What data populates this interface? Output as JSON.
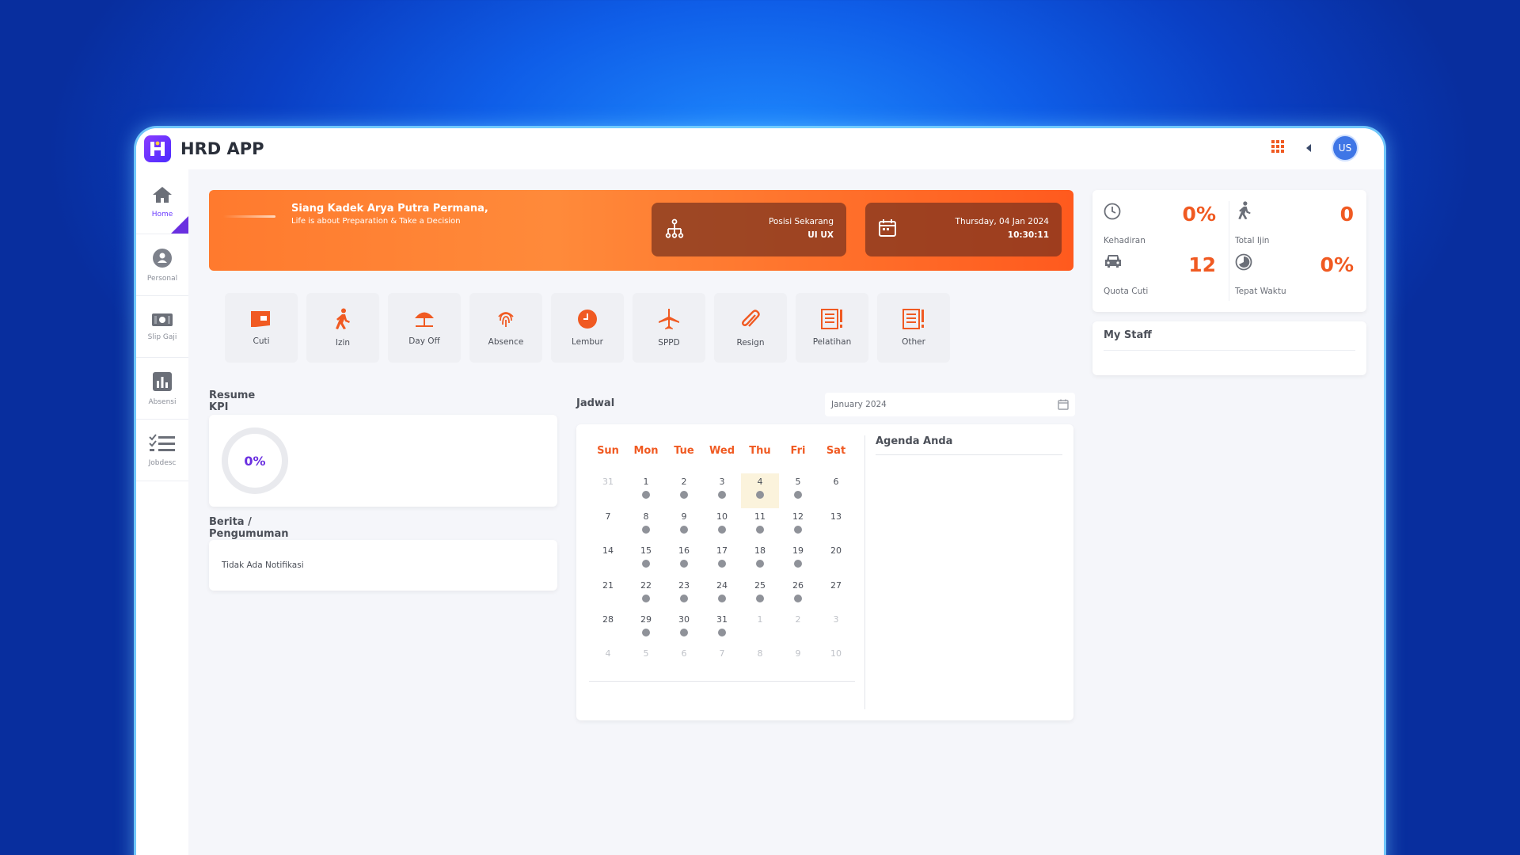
{
  "app": {
    "title": "HRD APP",
    "user_initials": "US"
  },
  "sidebar": {
    "items": [
      {
        "label": "Home",
        "icon": "home-icon",
        "active": true
      },
      {
        "label": "Personal",
        "icon": "user-icon",
        "active": false
      },
      {
        "label": "Slip Gaji",
        "icon": "money-icon",
        "active": false
      },
      {
        "label": "Absensi",
        "icon": "bar-chart-icon",
        "active": false
      },
      {
        "label": "Jobdesc",
        "icon": "checklist-icon",
        "active": false
      }
    ]
  },
  "banner": {
    "greeting": "Siang Kadek Arya Putra Permana,",
    "subtitle": "Life is about Preparation & Take a Decision",
    "position_label": "Posisi Sekarang",
    "position_value": "UI UX",
    "date": "Thursday, 04 Jan 2024",
    "time": "10:30:11"
  },
  "quick_actions": [
    {
      "label": "Cuti",
      "icon": "leave-icon"
    },
    {
      "label": "Izin",
      "icon": "walking-icon"
    },
    {
      "label": "Day Off",
      "icon": "beach-umbrella-icon"
    },
    {
      "label": "Absence",
      "icon": "fingerprint-icon"
    },
    {
      "label": "Lembur",
      "icon": "clock-icon"
    },
    {
      "label": "SPPD",
      "icon": "airplane-icon"
    },
    {
      "label": "Resign",
      "icon": "paperclip-icon"
    },
    {
      "label": "Pelatihan",
      "icon": "document-icon"
    },
    {
      "label": "Other",
      "icon": "document-icon"
    }
  ],
  "kpi": {
    "title": "Resume KPI",
    "value": "0%"
  },
  "news": {
    "title": "Berita / Pengumuman",
    "empty_text": "Tidak Ada Notifikasi"
  },
  "schedule": {
    "title": "Jadwal",
    "month_value": "January 2024",
    "agenda_title": "Agenda Anda",
    "weekdays": [
      "Sun",
      "Mon",
      "Tue",
      "Wed",
      "Thu",
      "Fri",
      "Sat"
    ],
    "weeks": [
      [
        "31",
        "1",
        "2",
        "3",
        "4",
        "5",
        "6"
      ],
      [
        "7",
        "8",
        "9",
        "10",
        "11",
        "12",
        "13"
      ],
      [
        "14",
        "15",
        "16",
        "17",
        "18",
        "19",
        "20"
      ],
      [
        "21",
        "22",
        "23",
        "24",
        "25",
        "26",
        "27"
      ],
      [
        "28",
        "29",
        "30",
        "31",
        "1",
        "2",
        "3"
      ],
      [
        "4",
        "5",
        "6",
        "7",
        "8",
        "9",
        "10"
      ]
    ]
  },
  "stats": {
    "kehadiran": {
      "label": "Kehadiran",
      "value": "0%"
    },
    "total_ijin": {
      "label": "Total Ijin",
      "value": "0"
    },
    "quota_cuti": {
      "label": "Quota Cuti",
      "value": "12"
    },
    "tepat_waktu": {
      "label": "Tepat Waktu",
      "value": "0%"
    }
  },
  "my_staff": {
    "title": "My Staff"
  },
  "colors": {
    "accent": "#f05a22",
    "primary": "#6a2fe0",
    "avatar": "#3f76e6"
  }
}
